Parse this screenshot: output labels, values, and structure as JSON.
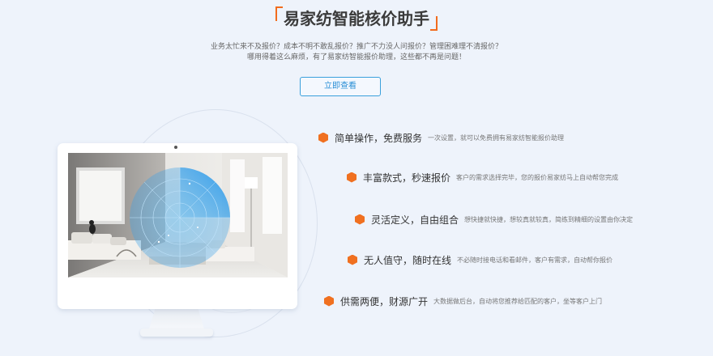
{
  "header": {
    "title": "易家纺智能核价助手",
    "subtitle_line1": "业务太忙来不及报价？成本不明不敢乱报价？推广不力没人问报价？管理困难理不清报价？",
    "subtitle_line2": "哪用得着这么麻烦，有了易家纺智能报价助理，这些都不再是问题！",
    "cta_label": "立即查看"
  },
  "colors": {
    "accent": "#f07020",
    "button": "#3aa0dc",
    "background": "#eef3fb",
    "radar": "#3aa7ee"
  },
  "features": [
    {
      "title": "简单操作，免费服务",
      "desc": "一次设置，就可以免费拥有易家纺智能报价助理"
    },
    {
      "title": "丰富款式，秒速报价",
      "desc": "客户的需求选择完毕，您的报价易家纺马上自动帮您完成"
    },
    {
      "title": "灵活定义，自由组合",
      "desc": "想快捷就快捷，想较真就较真，简练到精细的设置由你决定"
    },
    {
      "title": "无人值守，随时在线",
      "desc": "不必随时接电话和看邮件，客户有需求，自动帮你报价"
    },
    {
      "title": "供需两便，财源广开",
      "desc": "大数据做后台，自动将您推荐给匹配的客户，坐等客户上门"
    }
  ]
}
